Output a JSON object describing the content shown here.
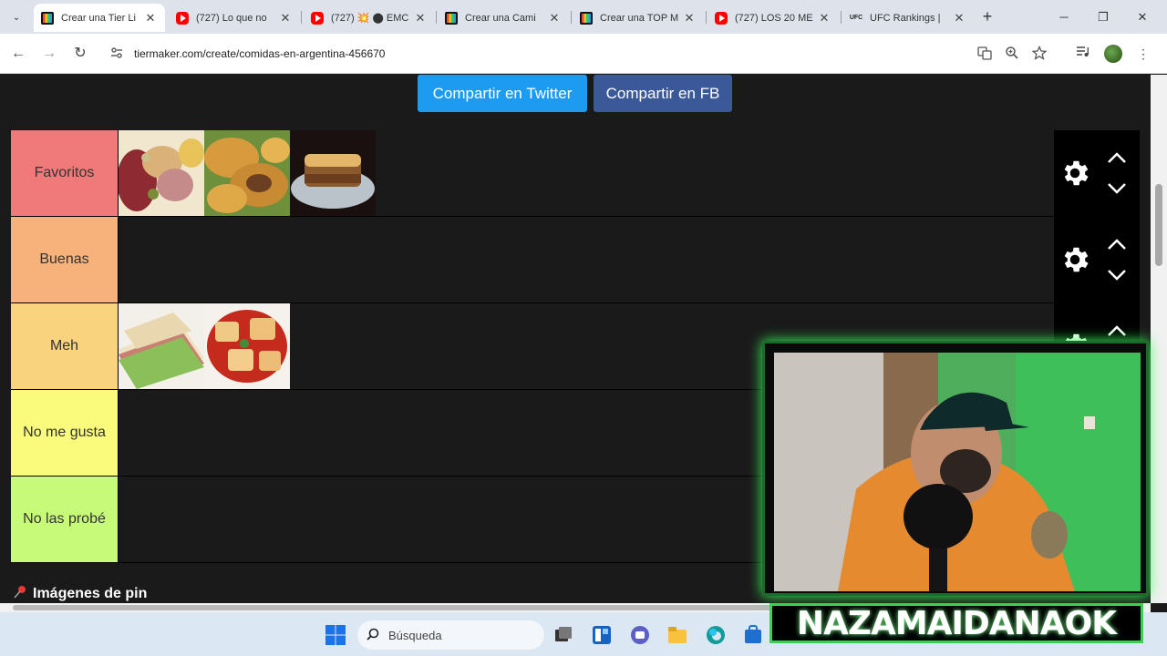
{
  "browser": {
    "tabs": [
      {
        "title": "Crear una Tier Li",
        "favicon": "tiermaker-icon",
        "active": true
      },
      {
        "title": "(727) Lo que no",
        "favicon": "youtube-icon",
        "active": false
      },
      {
        "title": "(727) 💥 ⬤ EMC",
        "favicon": "youtube-icon",
        "active": false
      },
      {
        "title": "Crear una Cami",
        "favicon": "tiermaker-icon",
        "active": false
      },
      {
        "title": "Crear una TOP M",
        "favicon": "tiermaker-icon",
        "active": false
      },
      {
        "title": "(727) LOS 20 ME",
        "favicon": "youtube-icon",
        "active": false
      },
      {
        "title": "UFC Rankings | ",
        "favicon": "ufc-icon",
        "active": false
      }
    ],
    "url": "tiermaker.com/create/comidas-en-argentina-456670",
    "glyphs": {
      "close": "✕",
      "new_tab": "+",
      "minimize": "─",
      "restore": "❐",
      "back": "←",
      "forward": "→",
      "reload": "↻",
      "menu": "⋮",
      "chevron": "⌄"
    }
  },
  "page": {
    "share_twitter": "Compartir en Twitter",
    "share_fb": "Compartir en FB",
    "pin_images": "Imágenes de pin",
    "tiers": [
      {
        "label": "Favoritos",
        "color": "#f07a7a",
        "items": [
          "picada-platter",
          "empanadas",
          "pastel-de-papa"
        ]
      },
      {
        "label": "Buenas",
        "color": "#f7b27c",
        "items": []
      },
      {
        "label": "Meh",
        "color": "#f9d37e",
        "items": [
          "sandwich-de-miga",
          "ravioles"
        ]
      },
      {
        "label": "No me gusta",
        "color": "#fafa7d",
        "items": []
      },
      {
        "label": "No las probé",
        "color": "#c8fa7a",
        "items": []
      }
    ]
  },
  "taskbar": {
    "search_placeholder": "Búsqueda"
  },
  "overlay": {
    "streamer_name": "NAZAMAIDANAOK",
    "accent": "#39d353"
  }
}
